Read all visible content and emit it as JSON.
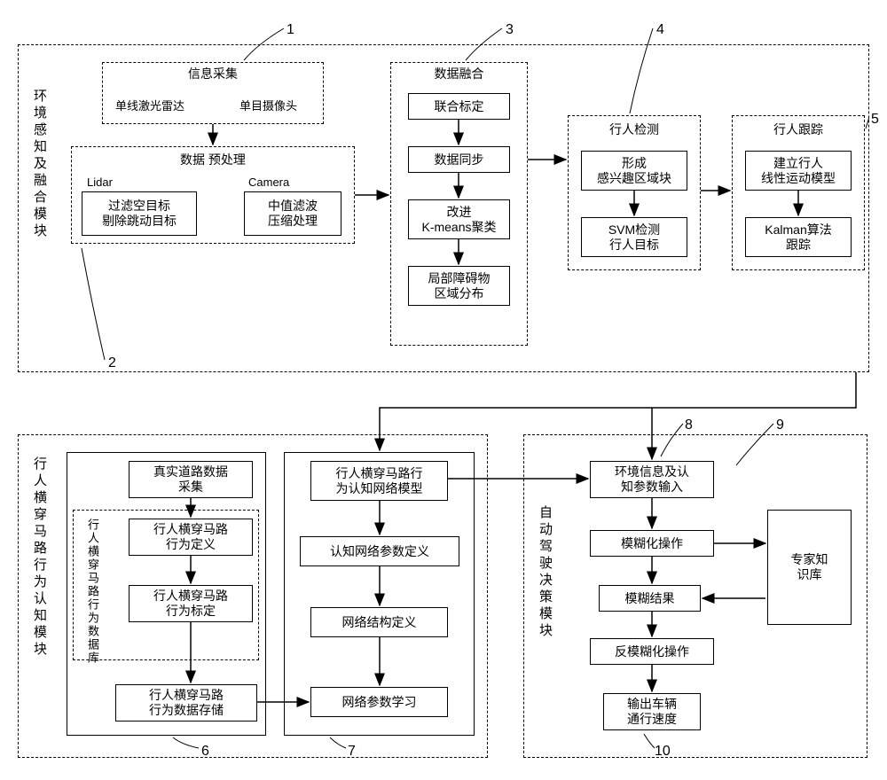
{
  "module1": {
    "title": "环境感知及融合模块",
    "info_collection": {
      "header": "信息采集",
      "left": "单线激光雷达",
      "right": "单目摄像头"
    },
    "preprocessing": {
      "header": "数据 预处理",
      "lidar_label": "Lidar",
      "lidar_line1": "过滤空目标",
      "lidar_line2": "剔除跳动目标",
      "camera_label": "Camera",
      "camera_line1": "中值滤波",
      "camera_line2": "压缩处理"
    },
    "fusion": {
      "header": "数据融合",
      "b1": "联合标定",
      "b2": "数据同步",
      "b3_l1": "改进",
      "b3_l2": "K-means聚类",
      "b4_l1": "局部障碍物",
      "b4_l2": "区域分布"
    },
    "detection": {
      "header": "行人检测",
      "b1_l1": "形成",
      "b1_l2": "感兴趣区域块",
      "b2_l1": "SVM检测",
      "b2_l2": "行人目标"
    },
    "tracking": {
      "header": "行人跟踪",
      "b1_l1": "建立行人",
      "b1_l2": "线性运动模型",
      "b2_l1": "Kalman算法",
      "b2_l2": "跟踪"
    }
  },
  "module2": {
    "title": "行人横穿马路行为认知模块",
    "left_block": {
      "b1_l1": "真实道路数据",
      "b1_l2": "采集",
      "db_label": "行人横穿马路行为数据库",
      "b2_l1": "行人横穿马路",
      "b2_l2": "行为定义",
      "b3_l1": "行人横穿马路",
      "b3_l2": "行为标定",
      "b4_l1": "行人横穿马路",
      "b4_l2": "行为数据存储"
    },
    "right_block": {
      "b1_l1": "行人横穿马路行",
      "b1_l2": "为认知网络模型",
      "b2": "认知网络参数定义",
      "b3": "网络结构定义",
      "b4": "网络参数学习"
    }
  },
  "module3": {
    "title": "自动驾驶决策模块",
    "b1_l1": "环境信息及认",
    "b1_l2": "知参数输入",
    "b2": "模糊化操作",
    "b3": "模糊结果",
    "b4": "反模糊化操作",
    "b5_l1": "输出车辆",
    "b5_l2": "通行速度",
    "kb_l1": "专家知",
    "kb_l2": "识库"
  },
  "nums": {
    "n1": "1",
    "n2": "2",
    "n3": "3",
    "n4": "4",
    "n5": "5",
    "n6": "6",
    "n7": "7",
    "n8": "8",
    "n9": "9",
    "n10": "10"
  }
}
